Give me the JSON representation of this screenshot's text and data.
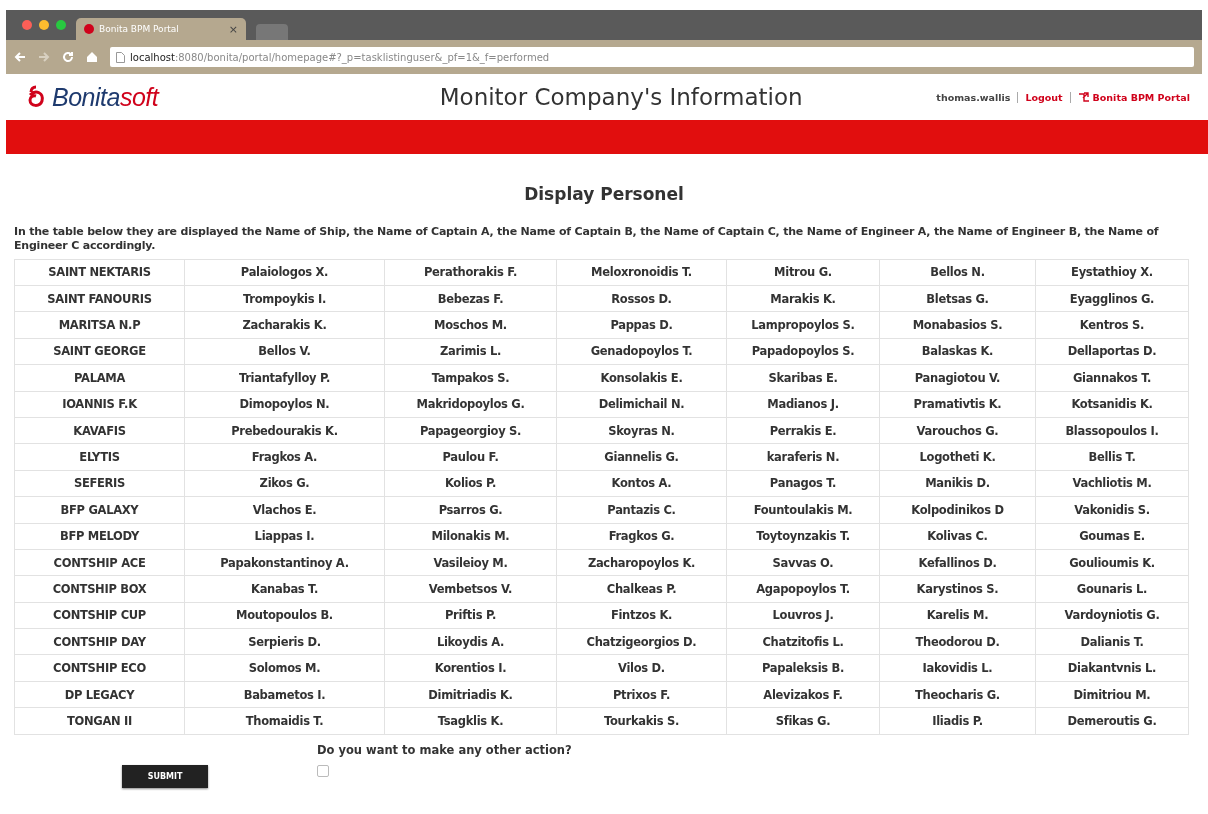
{
  "browser": {
    "tab_title": "Bonita BPM Portal",
    "tab_close": "×",
    "url_host": "localhost",
    "url_path": ":8080/bonita/portal/homepage#?_p=tasklistinguser&_pf=1&_f=performed"
  },
  "header": {
    "logo": {
      "primary": "Bonita",
      "accent": "soft"
    },
    "title": "Monitor Company's Information",
    "user": "thomas.wallis",
    "logout": "Logout",
    "portal_link": "Bonita BPM Portal"
  },
  "page": {
    "heading": "Display Personel",
    "description": "In the table below they are displayed the Name of Ship, the Name of Captain A, the Name of Captain B, the Name of Captain C, the Name of Engineer A, the Name of Engineer B, the Name of Engineer C accordingly."
  },
  "table": {
    "rows": [
      [
        "SAINT NEKTARIS",
        "Palaiologos X.",
        "Perathorakis F.",
        "Meloxronoidis T.",
        "Mitrou G.",
        "Bellos N.",
        "Eystathioy X."
      ],
      [
        "SAINT FANOURIS",
        "Trompoykis I.",
        "Bebezas F.",
        "Rossos D.",
        "Marakis K.",
        "Bletsas G.",
        "Eyagglinos G."
      ],
      [
        "MARITSA N.P",
        "Zacharakis K.",
        "Moschos M.",
        "Pappas D.",
        "Lampropoylos S.",
        "Monabasios S.",
        "Kentros S."
      ],
      [
        "SAINT GEORGE",
        "Bellos V.",
        "Zarimis L.",
        "Genadopoylos T.",
        "Papadopoylos S.",
        "Balaskas K.",
        "Dellaportas D."
      ],
      [
        "PALAMA",
        "Triantafylloy P.",
        "Tampakos S.",
        "Konsolakis E.",
        "Skaribas E.",
        "Panagiotou V.",
        "Giannakos T."
      ],
      [
        "IOANNIS F.K",
        "Dimopoylos N.",
        "Makridopoylos G.",
        "Delimichail N.",
        "Madianos J.",
        "Pramativtis K.",
        "Kotsanidis K."
      ],
      [
        "KAVAFIS",
        "Prebedourakis K.",
        "Papageorgioy S.",
        "Skoyras N.",
        "Perrakis E.",
        "Varouchos G.",
        "Blassopoulos I."
      ],
      [
        "ELYTIS",
        "Fragkos A.",
        "Paulou F.",
        "Giannelis G.",
        "karaferis N.",
        "Logotheti K.",
        "Bellis T."
      ],
      [
        "SEFERIS",
        "Zikos G.",
        "Kolios P.",
        "Kontos A.",
        "Panagos T.",
        "Manikis D.",
        "Vachliotis M."
      ],
      [
        "BFP GALAXY",
        "Vlachos E.",
        "Psarros G.",
        "Pantazis C.",
        "Fountoulakis M.",
        "Kolpodinikos D",
        "Vakonidis S."
      ],
      [
        "BFP MELODY",
        "Liappas I.",
        "Milonakis M.",
        "Fragkos G.",
        "Toytoynzakis T.",
        "Kolivas C.",
        "Goumas E."
      ],
      [
        "CONTSHIP ACE",
        "Papakonstantinoy A.",
        "Vasileioy M.",
        "Zacharopoylos K.",
        "Savvas O.",
        "Kefallinos D.",
        "Goulioumis K."
      ],
      [
        "CONTSHIP BOX",
        "Kanabas T.",
        "Vembetsos V.",
        "Chalkeas P.",
        "Agapopoylos T.",
        "Karystinos S.",
        "Gounaris L."
      ],
      [
        "CONTSHIP CUP",
        "Moutopoulos B.",
        "Priftis P.",
        "Fintzos K.",
        "Louvros J.",
        "Karelis M.",
        "Vardoyniotis G."
      ],
      [
        "CONTSHIP DAY",
        "Serpieris D.",
        "Likoydis A.",
        "Chatzigeorgios D.",
        "Chatzitofis L.",
        "Theodorou D.",
        "Dalianis T."
      ],
      [
        "CONTSHIP ECO",
        "Solomos M.",
        "Korentios I.",
        "Vilos D.",
        "Papaleksis B.",
        "Iakovidis L.",
        "Diakantvnis L."
      ],
      [
        "DP LEGACY",
        "Babametos I.",
        "Dimitriadis K.",
        "Ptrixos F.",
        "Alevizakos F.",
        "Theocharis G.",
        "Dimitriou M."
      ],
      [
        "TONGAN II",
        "Thomaidis T.",
        "Tsagklis K.",
        "Tourkakis S.",
        "Sfikas G.",
        "Iliadis P.",
        "Demeroutis G."
      ]
    ]
  },
  "form": {
    "submit": "SUBMIT",
    "question": "Do you want to make any other action?",
    "other_action": {
      "checked": false
    }
  }
}
